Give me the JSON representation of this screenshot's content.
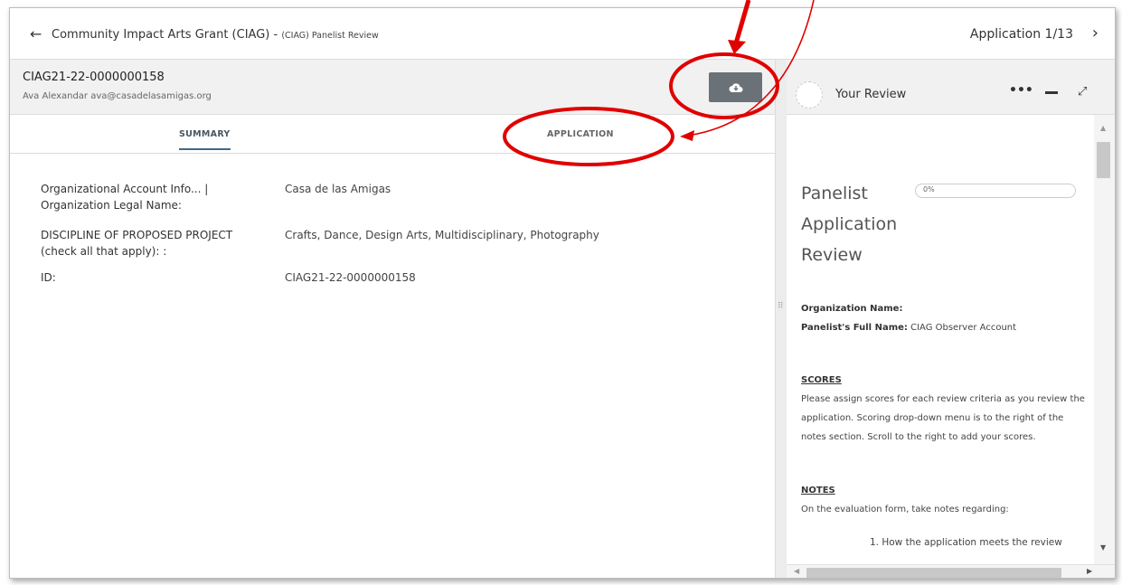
{
  "header": {
    "back_icon": "←",
    "title": "Community Impact Arts Grant (CIAG) - ",
    "subtitle": "(CIAG) Panelist Review",
    "app_counter": "Application 1/13",
    "next_icon": "›"
  },
  "applicant": {
    "id": "CIAG21-22-0000000158",
    "contact": "Ava Alexandar ava@casadelasamigas.org",
    "download_icon": "cloud-download-icon"
  },
  "tabs": {
    "summary": "SUMMARY",
    "application": "APPLICATION"
  },
  "summary": {
    "rows": [
      {
        "label": "Organizational Account Info... | Organization Legal Name:",
        "value": "Casa de las Amigas"
      },
      {
        "label": "DISCIPLINE OF PROPOSED PROJECT (check all that apply): :",
        "value": "Crafts, Dance, Design Arts, Multidisciplinary, Photography"
      },
      {
        "label": "ID:",
        "value": "CIAG21-22-0000000158"
      }
    ]
  },
  "review": {
    "label": "Your Review",
    "more": "•••",
    "expand": "⤢",
    "form_title": "Panelist Application Review",
    "progress": "0%",
    "org_name_label": "Organization Name:",
    "panelist_label": "Panelist's Full Name:",
    "panelist_value": "CIAG Observer Account",
    "scores_heading": "SCORES",
    "scores_text": "Please assign scores for each review criteria as you review the application. Scoring drop-down menu is to the right of the notes section. Scroll to the right to add your scores.",
    "notes_heading": "NOTES",
    "notes_text": "On the evaluation form, take notes regarding:",
    "list_item_1": "1. How the application meets the review"
  },
  "colors": {
    "annotation": "#e00000",
    "download_button": "#6b7277",
    "tab_underline": "#3f6a8a"
  }
}
